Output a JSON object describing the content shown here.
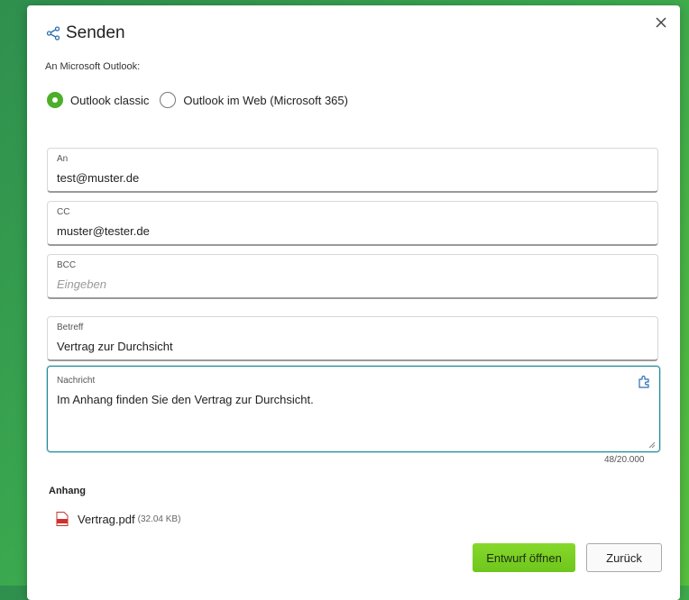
{
  "dialog": {
    "title": "Senden",
    "subtitle": "An Microsoft Outlook:"
  },
  "radio": {
    "option1": "Outlook classic",
    "option2": "Outlook im Web (Microsoft 365)",
    "selected": "option1"
  },
  "fields": {
    "to": {
      "label": "An",
      "value": "test@muster.de"
    },
    "cc": {
      "label": "CC",
      "value": "muster@tester.de"
    },
    "bcc": {
      "label": "BCC",
      "placeholder": "Eingeben"
    },
    "subject": {
      "label": "Betreff",
      "value": "Vertrag zur Durchsicht"
    },
    "message": {
      "label": "Nachricht",
      "value": "Im Anhang finden Sie den Vertrag zur Durchsicht.",
      "counter": "48/20.000"
    }
  },
  "attachment": {
    "heading": "Anhang",
    "file_name": "Vertrag.pdf",
    "file_size": "(32.04 KB)"
  },
  "buttons": {
    "primary": "Entwurf öffnen",
    "secondary": "Zurück"
  },
  "colors": {
    "accent": "#4caf2a",
    "primary_button": "#7ed321",
    "focus_border": "#1a8a9a",
    "icon_blue": "#2a6fb0"
  },
  "icons": {
    "share": "share-icon",
    "close": "close-icon",
    "addin": "puzzle-icon",
    "pdf": "pdf-file-icon"
  }
}
